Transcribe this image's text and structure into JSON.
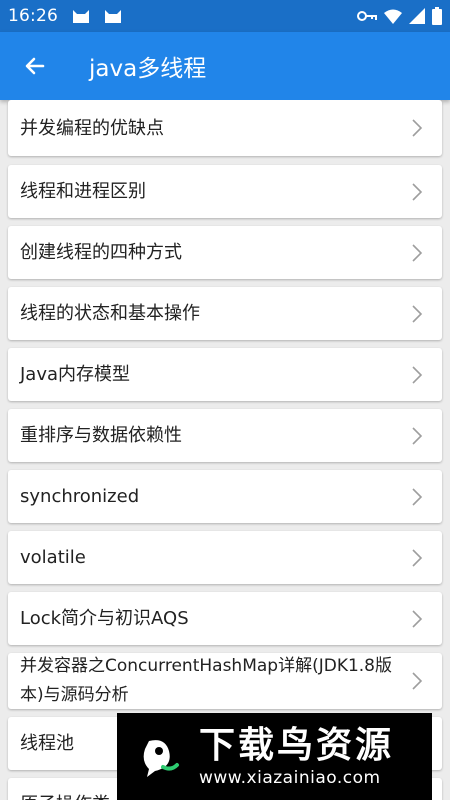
{
  "status_bar": {
    "time": "16:26",
    "left_icons": [
      "cat-icon",
      "cat-icon"
    ],
    "right_icons": [
      "key-icon",
      "wifi-icon",
      "signal-icon",
      "battery-icon"
    ]
  },
  "app_bar": {
    "title": "java多线程",
    "back_icon": "arrow-left-icon",
    "color": "#2185e9"
  },
  "list": {
    "items": [
      {
        "label": "并发编程的优缺点"
      },
      {
        "label": "线程和进程区别"
      },
      {
        "label": "创建线程的四种方式"
      },
      {
        "label": "线程的状态和基本操作"
      },
      {
        "label": "Java内存模型"
      },
      {
        "label": "重排序与数据依赖性"
      },
      {
        "label": "synchronized"
      },
      {
        "label": "volatile"
      },
      {
        "label": "Lock简介与初识AQS"
      },
      {
        "label": "并发容器之ConcurrentHashMap详解(JDK1.8版本)与源码分析"
      },
      {
        "label": "线程池"
      },
      {
        "label": "原子操作类"
      }
    ],
    "chevron_icon": "chevron-right-icon"
  },
  "watermark": {
    "name": "下载鸟资源",
    "url": "www.xiazainiao.com"
  }
}
